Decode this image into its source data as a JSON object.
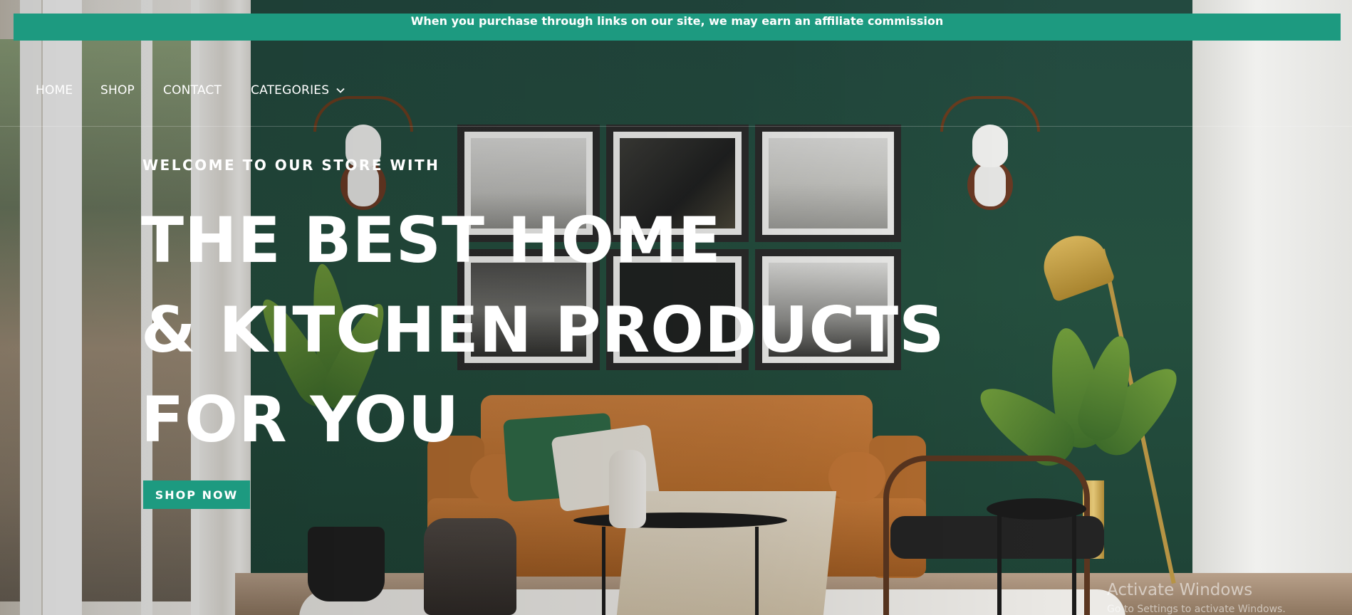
{
  "affiliate_bar": {
    "text": "When you purchase through links on our site, we may earn an affiliate commission"
  },
  "nav": {
    "items": [
      {
        "label": "HOME"
      },
      {
        "label": "SHOP"
      },
      {
        "label": "CONTACT"
      },
      {
        "label": "CATEGORIES",
        "icon": "chevron-down-icon"
      }
    ]
  },
  "hero": {
    "eyebrow": "WELCOME TO OUR STORE WITH",
    "title_lines": [
      "THE BEST HOME",
      "& KITCHEN PRODUCTS",
      "FOR YOU"
    ],
    "button_label": "SHOP NOW"
  },
  "watermark": {
    "title": "Activate Windows",
    "subtitle": "Go to Settings to activate Windows."
  },
  "colors": {
    "accent": "#1d9a80",
    "text_on_dark": "#ffffff",
    "wall_green": "#234a40"
  }
}
